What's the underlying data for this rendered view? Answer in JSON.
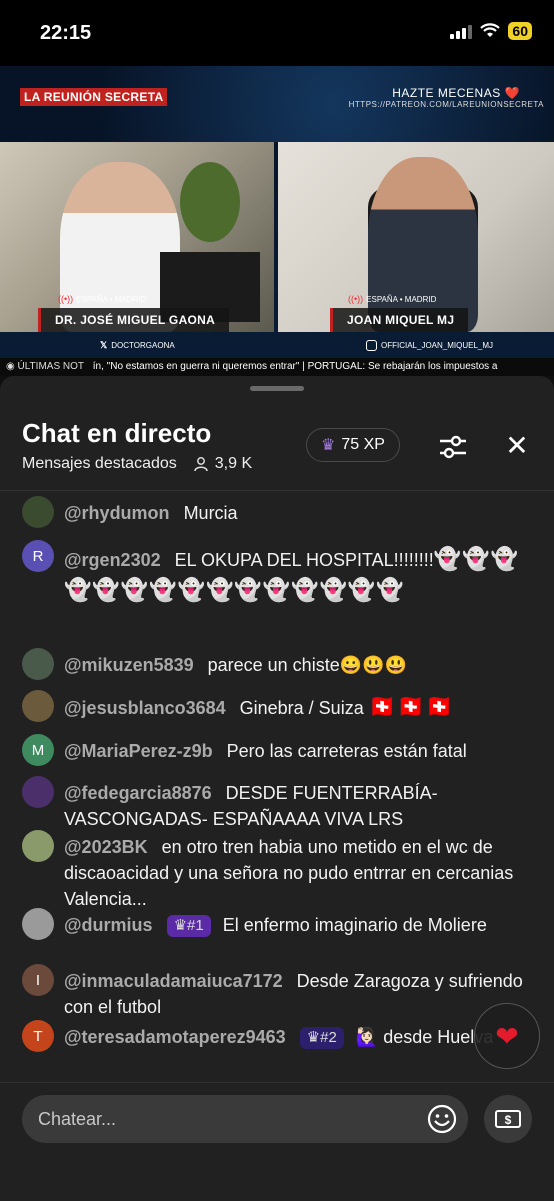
{
  "status": {
    "time": "22:15",
    "battery": "60"
  },
  "video": {
    "logo": "LA REUNIÓN SECRETA",
    "patreon_title": "HAZTE MECENAS ❤️",
    "patreon_url": "HTTPS://PATREON.COM/LAREUNIONSECRETA",
    "left": {
      "location": "ESPAÑA • MADRID",
      "name": "DR. JOSÉ MIGUEL GAONA",
      "handle": "DOCTORGAONA"
    },
    "right": {
      "location": "ESPAÑA • MADRID",
      "name": "JOAN MIQUEL MJ",
      "handle": "OFFICIAL_JOAN_MIQUEL_MJ"
    },
    "ticker_label": "ÚLTIMAS NOT",
    "ticker_text": "ín, \"No estamos en guerra ni queremos entrar\" | PORTUGAL: Se rebajarán los impuestos a"
  },
  "chat": {
    "title": "Chat en directo",
    "subtitle": "Mensajes destacados",
    "viewers": "3,9 K",
    "xp": "75 XP",
    "messages": [
      {
        "author": "@rhydumon",
        "text": "Murcia",
        "avatar": "",
        "avatar_color": "#3b4b2f"
      },
      {
        "author": "@rgen2302",
        "text": "EL OKUPA DEL HOSPITAL!!!!!!!!",
        "emojis": "👻👻👻👻👻👻👻👻👻👻👻👻👻👻👻",
        "avatar": "R",
        "avatar_color": "#5a4fb3"
      },
      {
        "author": "@mikuzen5839",
        "text": "parece un chiste😀😃😃",
        "avatar": "",
        "avatar_color": "#4a5a4a"
      },
      {
        "author": "@jesusblanco3684",
        "text": "Ginebra / Suiza",
        "emojis": "🇨🇭🇨🇭🇨🇭",
        "avatar": "",
        "avatar_color": "#6b5a3c"
      },
      {
        "author": "@MariaPerez-z9b",
        "text": "Pero las carreteras están fatal",
        "avatar": "M",
        "avatar_color": "#3f8a5e"
      },
      {
        "author": "@fedegarcia8876",
        "text": "DESDE FUENTERRABÍA-VASCONGADAS- ESPAÑAAAA VIVA LRS",
        "avatar": "",
        "avatar_color": "#4b2f6b"
      },
      {
        "author": "@2023BK",
        "text": "en otro tren habia uno metido en el wc de discaoacidad y una señora no pudo entrrar en cercanias Valencia...",
        "avatar": "",
        "avatar_color": "#8a9a6a"
      },
      {
        "author": "@durmius",
        "badge": "#1",
        "text": "El enfermo imaginario de Moliere",
        "avatar": "",
        "avatar_color": "#9a9a9a"
      },
      {
        "author": "@inmaculadamaiuca7172",
        "text": "Desde Zaragoza y sufriendo con el futbol",
        "avatar": "I",
        "avatar_color": "#6b4a3c"
      },
      {
        "author": "@teresadamotaperez9463",
        "badge": "#2",
        "text": "🙋🏻‍♀️ desde Huelva",
        "avatar": "T",
        "avatar_color": "#c4451c"
      }
    ]
  },
  "input": {
    "placeholder": "Chatear..."
  }
}
